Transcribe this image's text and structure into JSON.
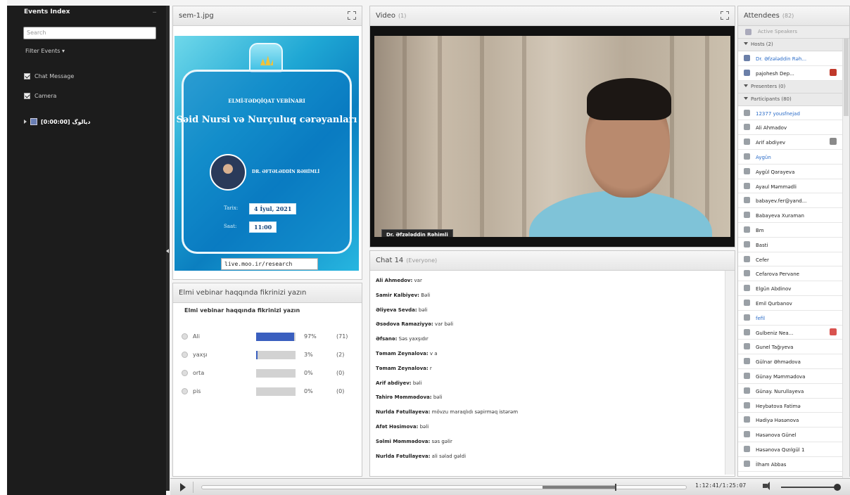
{
  "left_panel": {
    "title": "Events Index",
    "search_placeholder": "Search",
    "filter_label": "Filter Events",
    "checks": [
      "Chat Message",
      "Camera"
    ],
    "tree_item": "دیالوگ [0:00:00]"
  },
  "share_pod": {
    "title": "sem-1.jpg",
    "slide": {
      "small_title": "ELMİ-TƏDQİQAT VEBİNARI",
      "big_title": "Səid Nursi və Nurçuluq cərəyanları",
      "presenter": "DR. ƏFTƏLƏDDİN RƏHİMLİ",
      "date_label": "Tarix:",
      "date": "4 İyul, 2021",
      "time_label": "Saat:",
      "time": "11:00",
      "url": "live.moo.ir/research"
    }
  },
  "poll_pod": {
    "title": "Elmi vebinar haqqında fikrinizi yazın",
    "question": "Elmi vebinar haqqında fikrinizi yazın",
    "options": [
      {
        "label": "Ali",
        "percent": 97,
        "pct_text": "97%",
        "count": "(71)"
      },
      {
        "label": "yaxşı",
        "percent": 3,
        "pct_text": "3%",
        "count": "(2)"
      },
      {
        "label": "orta",
        "percent": 0,
        "pct_text": "0%",
        "count": "(0)"
      },
      {
        "label": "pis",
        "percent": 0,
        "pct_text": "0%",
        "count": "(0)"
      }
    ]
  },
  "video_pod": {
    "title": "Video",
    "count": "(1)",
    "name_tag": "Dr. Əfzələddin Rəhimli"
  },
  "chat_pod": {
    "title": "Chat",
    "count": "14",
    "audience": "(Everyone)",
    "messages": [
      {
        "name": "Ali Ahmedov:",
        "text": "var"
      },
      {
        "name": "Samir Kalbiyev:",
        "text": "Bəli"
      },
      {
        "name": "Əliyeva Sevda:",
        "text": "bəli"
      },
      {
        "name": "Əsədova Ramaziyyə:",
        "text": "var bəli"
      },
      {
        "name": "Əfsanə:",
        "text": "Səs yaxşıdır"
      },
      {
        "name": "Təmam Zeynalova:",
        "text": "v a"
      },
      {
        "name": "Təmam Zeynalova:",
        "text": "r"
      },
      {
        "name": "Arif abdiyev:",
        "text": "bəli"
      },
      {
        "name": "Tahirə Məmmədova:",
        "text": "bəli"
      },
      {
        "name": "Nurlda Fətullayeva:",
        "text": "mövzu maraqlıdı səpirməq istərəm"
      },
      {
        "name": "Afət Həsimova:",
        "text": "bəli"
      },
      {
        "name": "Səlmi Məmmədova:",
        "text": "səs gəlir"
      },
      {
        "name": "Nurlda Fətullayeva:",
        "text": "ali səlad gəldi"
      }
    ]
  },
  "attendees_pod": {
    "title": "Attendees",
    "count": "(82)",
    "active_speakers": "Active Speakers",
    "hosts_label": "Hosts (2)",
    "hosts": [
      "Dr. Əfzələddin Rəh...",
      "pajohesh Dep..."
    ],
    "presenters_label": "Presenters (0)",
    "participants_label": "Participants (80)",
    "participants": [
      {
        "name": "12377 yousfnejad",
        "blue": true
      },
      {
        "name": "Ali Ahmadov",
        "blue": false
      },
      {
        "name": "Arif abdiyev",
        "blue": false
      },
      {
        "name": "Aygün",
        "blue": true
      },
      {
        "name": "Aygül Qarayeva",
        "blue": false
      },
      {
        "name": "Ayaul Məmmədli",
        "blue": false
      },
      {
        "name": "babayev.fer@yand...",
        "blue": false
      },
      {
        "name": "Babayeva Xuraman",
        "blue": false
      },
      {
        "name": "Bm",
        "blue": false
      },
      {
        "name": "Basti",
        "blue": false
      },
      {
        "name": "Cefer",
        "blue": false
      },
      {
        "name": "Cefarova Pervane",
        "blue": false
      },
      {
        "name": "Elgün Abdinov",
        "blue": false
      },
      {
        "name": "Emil Qurbanov",
        "blue": false
      },
      {
        "name": "fefil",
        "blue": true
      },
      {
        "name": "Gulbeniz Nea...",
        "blue": false
      },
      {
        "name": "Gunel Tağıyeva",
        "blue": false
      },
      {
        "name": "Gülnar Əhmədova",
        "blue": false
      },
      {
        "name": "Günay Məmmədova",
        "blue": false
      },
      {
        "name": "Günay. Nurullayeva",
        "blue": false
      },
      {
        "name": "Heybətova Fatimə",
        "blue": false
      },
      {
        "name": "Hədiyə Həsənova",
        "blue": false
      },
      {
        "name": "Həsənova Günel",
        "blue": false
      },
      {
        "name": "Həsənova Qızılgül 1",
        "blue": false
      },
      {
        "name": "İlham Abbas",
        "blue": false
      }
    ]
  },
  "player": {
    "time": "1:12:41/1:25:07",
    "progress": 0.853,
    "buffer": 0.853,
    "volume": 1.0
  },
  "colors": {
    "poll_bar": "#3a5fbf",
    "link_blue": "#2b6cc8"
  }
}
